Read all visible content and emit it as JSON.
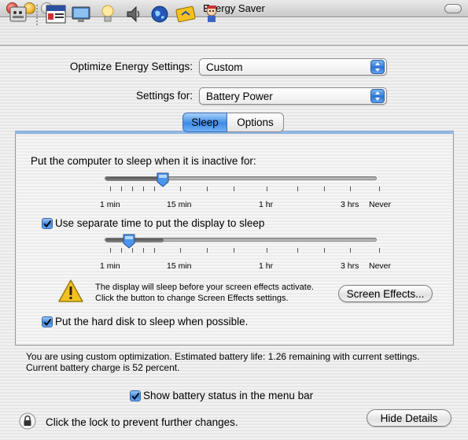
{
  "window": {
    "title": "Energy Saver"
  },
  "toolbar": {
    "icons": [
      "apple-menu-icon",
      "file-new-icon",
      "display-icon",
      "lightbulb-icon",
      "speaker-icon",
      "globe-icon",
      "road-sign-icon",
      "character-icon"
    ]
  },
  "optimize": {
    "label": "Optimize Energy Settings:",
    "value": "Custom"
  },
  "settings_for": {
    "label": "Settings for:",
    "value": "Battery Power"
  },
  "tabs": [
    {
      "label": "Sleep",
      "selected": true
    },
    {
      "label": "Options",
      "selected": false
    }
  ],
  "sleep": {
    "computer_label": "Put the computer to sleep when it is inactive for:",
    "computer_value": "15 min",
    "display_checkbox_label": "Use separate time to put the display to sleep",
    "display_checked": true,
    "display_value": "5 min",
    "tick_labels": [
      "1 min",
      "15 min",
      "1 hr",
      "3 hrs",
      "Never"
    ],
    "warning_line1": "The display will sleep before your screen effects activate.",
    "warning_line2": "Click the button to change Screen Effects settings.",
    "screen_effects_button": "Screen Effects...",
    "harddisk_label": "Put the hard disk to sleep when possible.",
    "harddisk_checked": true
  },
  "status": {
    "line1": "You are using custom optimization. Estimated battery life: 1.26 remaining with current settings.",
    "line2": "Current battery charge is 52 percent."
  },
  "menubar_checkbox": {
    "label": "Show battery status in the menu bar",
    "checked": true
  },
  "lock": {
    "label": "Click the lock to prevent further changes."
  },
  "hide_details_button": "Hide Details",
  "colors": {
    "accent": "#3c8be8",
    "warning": "#f3c21f"
  }
}
